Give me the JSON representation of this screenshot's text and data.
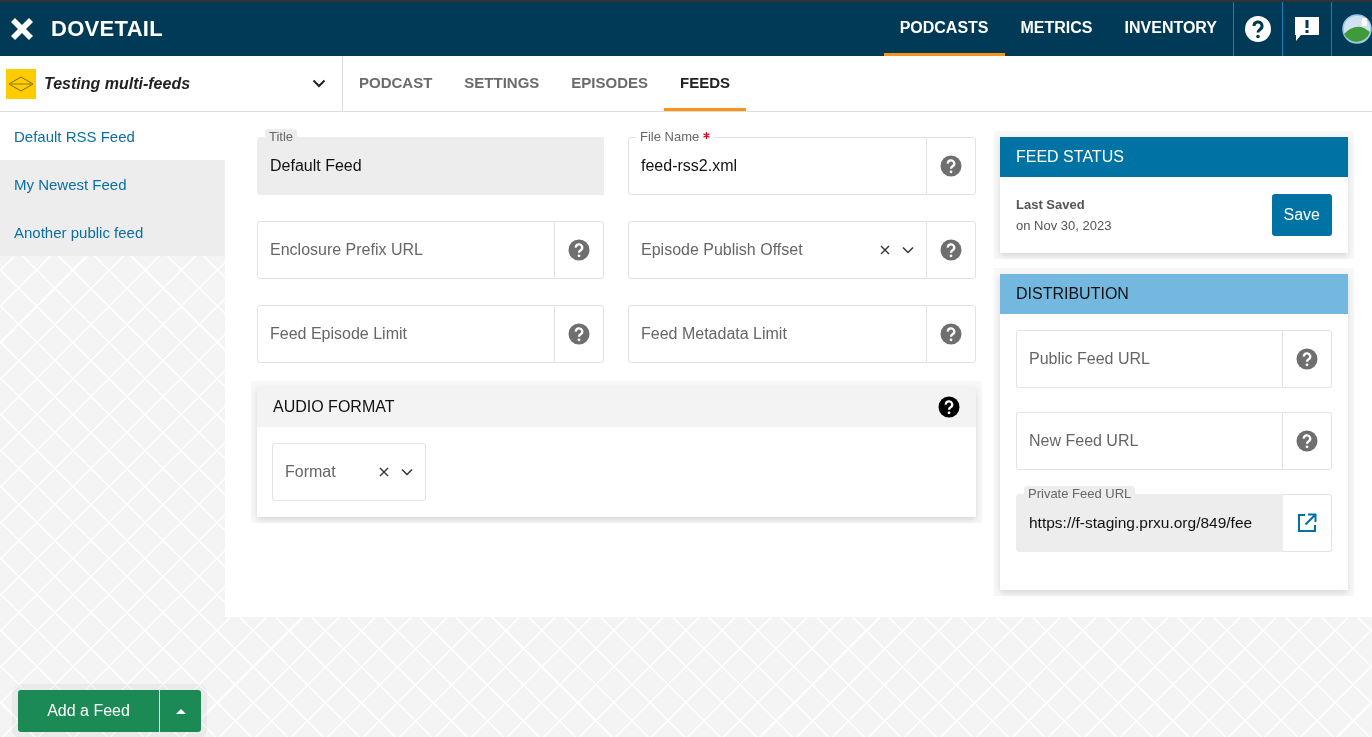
{
  "brand": {
    "name": "DOVETAIL"
  },
  "nav": [
    {
      "label": "PODCASTS",
      "selected": true
    },
    {
      "label": "METRICS",
      "selected": false
    },
    {
      "label": "INVENTORY",
      "selected": false
    }
  ],
  "podcast_selector": {
    "name": "Testing multi-feeds"
  },
  "tabs": [
    {
      "label": "PODCAST",
      "selected": false
    },
    {
      "label": "SETTINGS",
      "selected": false
    },
    {
      "label": "EPISODES",
      "selected": false
    },
    {
      "label": "FEEDS",
      "selected": true
    }
  ],
  "sidebar": {
    "items": [
      {
        "label": "Default RSS Feed",
        "selected": true
      },
      {
        "label": "My Newest Feed",
        "selected": false
      },
      {
        "label": "Another public feed",
        "selected": false
      }
    ]
  },
  "form": {
    "fields": [
      {
        "kind": "readonly",
        "label": "Title",
        "value": "Default Feed",
        "required": false
      },
      {
        "kind": "text",
        "label": "File Name",
        "value": "feed-rss2.xml",
        "required": true
      },
      {
        "kind": "text",
        "placeholder": "Enclosure Prefix URL",
        "required": false
      },
      {
        "kind": "select",
        "placeholder": "Episode Publish Offset",
        "required": false
      },
      {
        "kind": "text",
        "placeholder": "Feed Episode Limit",
        "required": false
      },
      {
        "kind": "text",
        "placeholder": "Feed Metadata Limit",
        "required": false
      }
    ]
  },
  "audio_format": {
    "title": "AUDIO FORMAT",
    "fields": [
      {
        "kind": "select",
        "placeholder": "Format"
      }
    ]
  },
  "feed_status": {
    "title": "FEED STATUS",
    "last_saved_label": "Last Saved",
    "last_saved_date": "on Nov 30, 2023",
    "save_button": "Save"
  },
  "distribution": {
    "title": "DISTRIBUTION",
    "fields": [
      {
        "kind": "text",
        "placeholder": "Public Feed URL"
      },
      {
        "kind": "text",
        "placeholder": "New Feed URL"
      },
      {
        "kind": "link",
        "label": "Private Feed URL",
        "value": "https://f-staging.prxu.org/849/fee"
      }
    ]
  },
  "add_feed_button": {
    "label": "Add a Feed"
  }
}
